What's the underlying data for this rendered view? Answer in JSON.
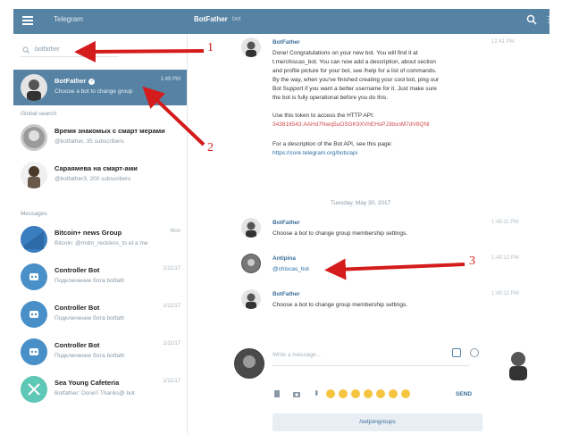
{
  "header": {
    "app_title": "Telegram",
    "chat_title": "BotFather",
    "chat_status": "bot"
  },
  "sidebar": {
    "search_placeholder": "botfather",
    "section_global": "Global search",
    "section_messages": "Messages",
    "active_chat": {
      "name": "BotFather",
      "preview": "Choose a bot to change group",
      "time": "1:49 PM"
    },
    "global_results": [
      {
        "name": "Время знакомых с смарт мерами",
        "sub": "@botfather, 35 subscribers"
      },
      {
        "name": "Сараямева на смарт-ами",
        "sub": "@botfather3, 200 subscribers"
      }
    ],
    "messages": [
      {
        "name": "Bitcoin+ news Group",
        "sub": "Bitcoin: @rndm_reckless_to et a me",
        "time": "Mon"
      },
      {
        "name": "Controller Bot",
        "sub": "Подключение бота botfath",
        "time": "1/11/17"
      },
      {
        "name": "Controller Bot",
        "sub": "Подключение бота botfath",
        "time": "1/11/17"
      },
      {
        "name": "Controller Bot",
        "sub": "Подключение бота botfath",
        "time": "1/11/17"
      },
      {
        "name": "Sea Young Cafeteria",
        "sub": "Botfather: Done!! Thanks@ bot",
        "time": "1/11/17"
      }
    ]
  },
  "chat": {
    "first_message": {
      "name": "BotFather",
      "time": "12:41 PM",
      "lines": [
        "Done! Congratulations on your new bot. You will find it at",
        "t.me/chiscas_bot. You can now add a description, about section",
        "and profile picture for your bot, see /help for a list of commands.",
        "By the way, when you've finished creating your cool bot, ping our",
        "Bot Support if you want a better username for it. Just make sure",
        "the bot is fully operational before you do this.",
        "",
        "Use this token to access the HTTP API:",
        "343616543:AAHd7Nwq5uOSGK9XVhEHsPJ3bsnM7dV8QNl",
        "",
        "For a description of the Bot API, see this page:",
        "https://core.telegram.org/bots/api"
      ]
    },
    "date_separator": "Tuesday, May 30, 2017",
    "messages": [
      {
        "name": "BotFather",
        "text": "Choose a bot to change group membership settings.",
        "time": "1:49:11 PM"
      },
      {
        "name": "Antipina",
        "text": "@chiscas_bot",
        "time": "1:49:12 PM"
      },
      {
        "name": "BotFather",
        "text": "Choose a bot to change group membership settings.",
        "time": "1:49:12 PM"
      }
    ],
    "composer_placeholder": "Write a message...",
    "send_label": "SEND",
    "bottom_button": "/setjoingroups"
  },
  "annotations": {
    "one": "1",
    "two": "2",
    "three": "3"
  },
  "colors": {
    "accent": "#5682a3",
    "arrow": "#d41c1c"
  }
}
